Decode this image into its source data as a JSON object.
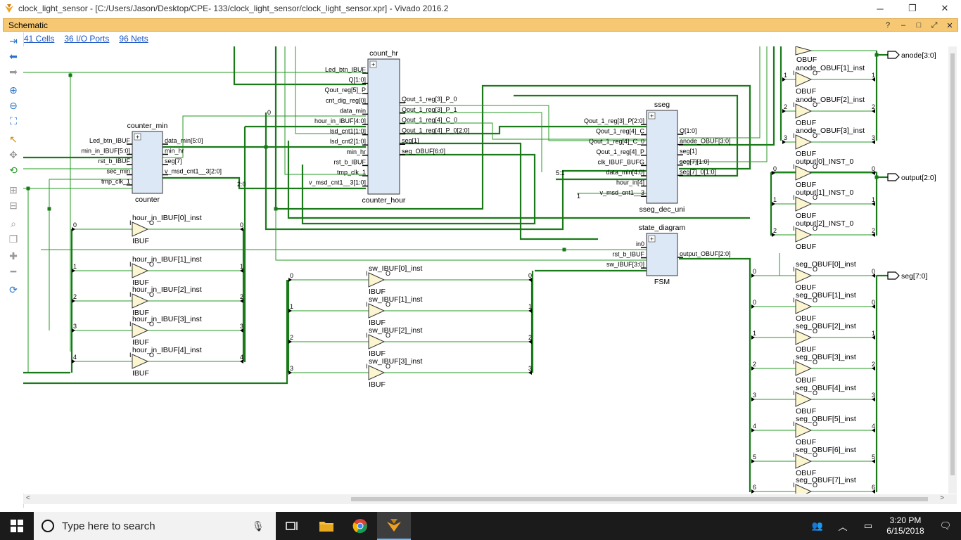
{
  "window": {
    "title": "clock_light_sensor - [C:/Users/Jason/Desktop/CPE- 133/clock_light_sensor/clock_light_sensor.xpr] - Vivado 2016.2",
    "app_icon": "vivado-icon"
  },
  "panel": {
    "title": "Schematic",
    "buttons": [
      "?",
      "–",
      "□",
      "⤢",
      "✕"
    ]
  },
  "summary": {
    "cells": "41 Cells",
    "io_ports": "36 I/O Ports",
    "nets": "96 Nets"
  },
  "toolbar": [
    "fit-icon",
    "back-icon",
    "forward-icon",
    "zoom-in-icon",
    "zoom-out-icon",
    "zoom-fit-icon",
    "select-icon",
    "route-icon",
    "regenerate-icon",
    "expand-icon",
    "collapse-icon",
    "search-icon",
    "copy-icon",
    "add-icon",
    "remove-icon",
    "refresh-icon"
  ],
  "schematic": {
    "counter_min": {
      "title": "counter_min",
      "type": "counter",
      "inputs": [
        "Led_btn_IBUF",
        "min_in_IBUF[5:0]",
        "rst_b_IBUF",
        "sec_min",
        "tmp_clk_1"
      ],
      "outputs": [
        "data_min[5:0]",
        "min_hr",
        "seg[7]",
        "v_msd_cnt1__3[2:0]"
      ]
    },
    "count_hr": {
      "title": "count_hr",
      "type": "counter_hour",
      "inputs": [
        "Led_btn_IBUF",
        "Q[1:0]",
        "Qout_reg[5]_P",
        "cnt_dig_reg[0]",
        "data_min",
        "hour_in_IBUF[4:0]",
        "lsd_cnt1[1:0]",
        "lsd_cnt2[1:0]",
        "min_hr",
        "rst_b_IBUF",
        "tmp_clk_1",
        "v_msd_cnt1__3[1:0]"
      ],
      "outputs": [
        "Qout_1_reg[3]_P_0",
        "Qout_1_reg[3]_P_1",
        "Qout_1_reg[4]_C_0",
        "Qout_1_reg[4]_P_0[2:0]",
        "seg[1]",
        "seg_OBUF[6:0]"
      ]
    },
    "sseg": {
      "title": "sseg",
      "type": "sseg_dec_uni",
      "inputs": [
        "Qout_1_reg[3]_P[2:0]",
        "Qout_1_reg[4]_C",
        "Qout_1_reg[4]_C_0",
        "Qout_1_reg[4]_P",
        "clk_IBUF_BUFG",
        "data_min[4:0]",
        "hour_in[4]",
        "v_msd_cnt1__3"
      ],
      "outputs": [
        "Q[1:0]",
        "anode_OBUF[3:0]",
        "seg[1]",
        "seg[7][1:0]",
        "seg[7]_0[1:0]"
      ]
    },
    "state_diagram": {
      "title": "state_diagram",
      "type": "FSM",
      "inputs": [
        "in0",
        "rst_b_IBUF",
        "sw_IBUF[3:0]"
      ],
      "outputs": [
        "output_OBUF[2:0]"
      ]
    },
    "hour_ibufs": [
      "hour_in_IBUF[0]_inst",
      "hour_in_IBUF[1]_inst",
      "hour_in_IBUF[2]_inst",
      "hour_in_IBUF[3]_inst",
      "hour_in_IBUF[4]_inst"
    ],
    "sw_ibufs": [
      "sw_IBUF[0]_inst",
      "sw_IBUF[1]_inst",
      "sw_IBUF[2]_inst",
      "sw_IBUF[3]_inst"
    ],
    "anode_obufs": [
      "anode_OBUF[1]_inst",
      "anode_OBUF[2]_inst",
      "anode_OBUF[3]_inst"
    ],
    "output_obufs": [
      "output[0]_INST_0",
      "output[1]_INST_0",
      "output[2]_INST_0"
    ],
    "seg_obufs": [
      "seg_OBUF[0]_inst",
      "seg_OBUF[1]_inst",
      "seg_OBUF[2]_inst",
      "seg_OBUF[3]_inst",
      "seg_OBUF[4]_inst",
      "seg_OBUF[5]_inst",
      "seg_OBUF[6]_inst",
      "seg_OBUF[7]_inst"
    ],
    "ibuf_type": "IBUF",
    "obuf_type": "OBUF",
    "ports": [
      "anode[3:0]",
      "output[2:0]",
      "seg[7:0]"
    ],
    "pin_in": "I",
    "pin_out": "O"
  },
  "taskbar": {
    "search_placeholder": "Type here to search",
    "time": "3:20 PM",
    "date": "6/15/2018"
  }
}
